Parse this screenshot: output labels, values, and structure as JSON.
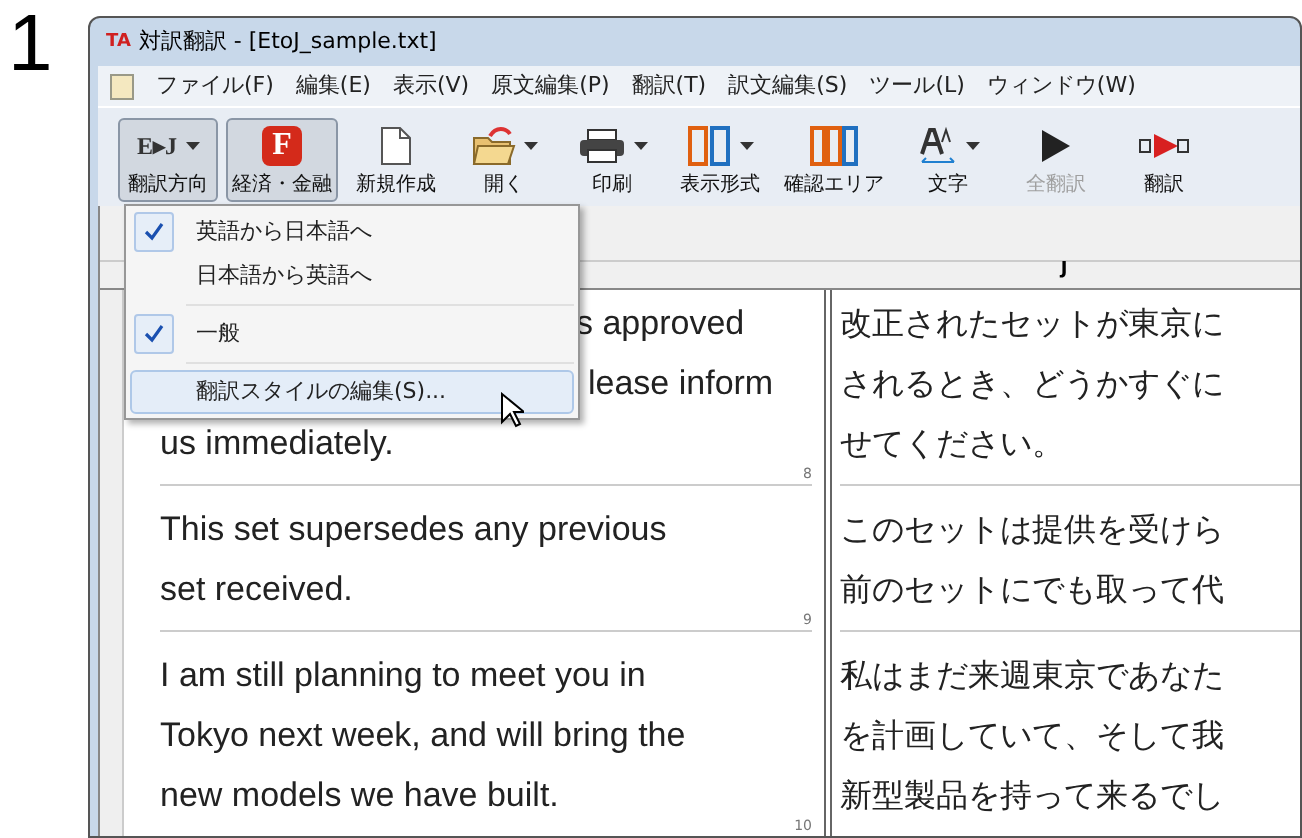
{
  "step_number": "1",
  "window": {
    "logo": "TA",
    "title": "対訳翻訳 - [EtoJ_sample.txt]"
  },
  "menu_bar": [
    "ファイル(F)",
    "編集(E)",
    "表示(V)",
    "原文編集(P)",
    "翻訳(T)",
    "訳文編集(S)",
    "ツール(L)",
    "ウィンドウ(W)"
  ],
  "toolbar": [
    {
      "kind": "direction",
      "icon_text": "E▸J",
      "label": "翻訳方向",
      "pressed": true,
      "dropdown": true,
      "disabled": false
    },
    {
      "kind": "field",
      "icon_text": "F",
      "label": "経済・金融",
      "pressed": true,
      "dropdown": false,
      "disabled": false
    },
    {
      "kind": "new",
      "label": "新規作成",
      "pressed": false,
      "dropdown": false,
      "disabled": false
    },
    {
      "kind": "open",
      "label": "開く",
      "pressed": false,
      "dropdown": true,
      "disabled": false
    },
    {
      "kind": "print",
      "label": "印刷",
      "pressed": false,
      "dropdown": true,
      "disabled": false
    },
    {
      "kind": "layout",
      "label": "表示形式",
      "pressed": false,
      "dropdown": true,
      "disabled": false
    },
    {
      "kind": "check",
      "label": "確認エリア",
      "pressed": false,
      "dropdown": false,
      "disabled": false
    },
    {
      "kind": "font",
      "label": "文字",
      "pressed": false,
      "dropdown": true,
      "disabled": false
    },
    {
      "kind": "all",
      "label": "全翻訳",
      "pressed": false,
      "dropdown": false,
      "disabled": true
    },
    {
      "kind": "translate",
      "label": "翻訳",
      "pressed": false,
      "dropdown": false,
      "disabled": false
    }
  ],
  "dropdown_menu": [
    {
      "kind": "item",
      "label": "英語から日本語へ",
      "checked": true,
      "selected": false
    },
    {
      "kind": "item",
      "label": "日本語から英語へ",
      "checked": false,
      "selected": false
    },
    {
      "kind": "separator"
    },
    {
      "kind": "item",
      "label": "一般",
      "checked": true,
      "selected": false
    },
    {
      "kind": "separator"
    },
    {
      "kind": "item",
      "label": "翻訳スタイルの編集(S)...",
      "checked": false,
      "selected": true
    }
  ],
  "target_header": "J",
  "segments": [
    {
      "source": [
        {
          "text": "s approved",
          "covered": true
        },
        {
          "text": "lease inform",
          "covered": true
        },
        {
          "text": "us immediately."
        }
      ],
      "target": [
        "改正されたセットが東京に",
        "されるとき、どうかすぐに",
        "せてください。"
      ],
      "number": "8"
    },
    {
      "source": [
        {
          "text": "This set supersedes any previous"
        },
        {
          "text": "set received."
        }
      ],
      "target": [
        "このセットは提供を受けら",
        "前のセットにでも取って代"
      ],
      "number": "9"
    },
    {
      "source": [
        {
          "text": "I am still planning to meet you in"
        },
        {
          "text": "Tokyo next week, and will bring the"
        },
        {
          "text": "new models we have built."
        }
      ],
      "target": [
        "私はまだ来週東京であなた",
        "を計画していて、そして我",
        "新型製品を持って来るでし"
      ],
      "number": "10"
    }
  ]
}
